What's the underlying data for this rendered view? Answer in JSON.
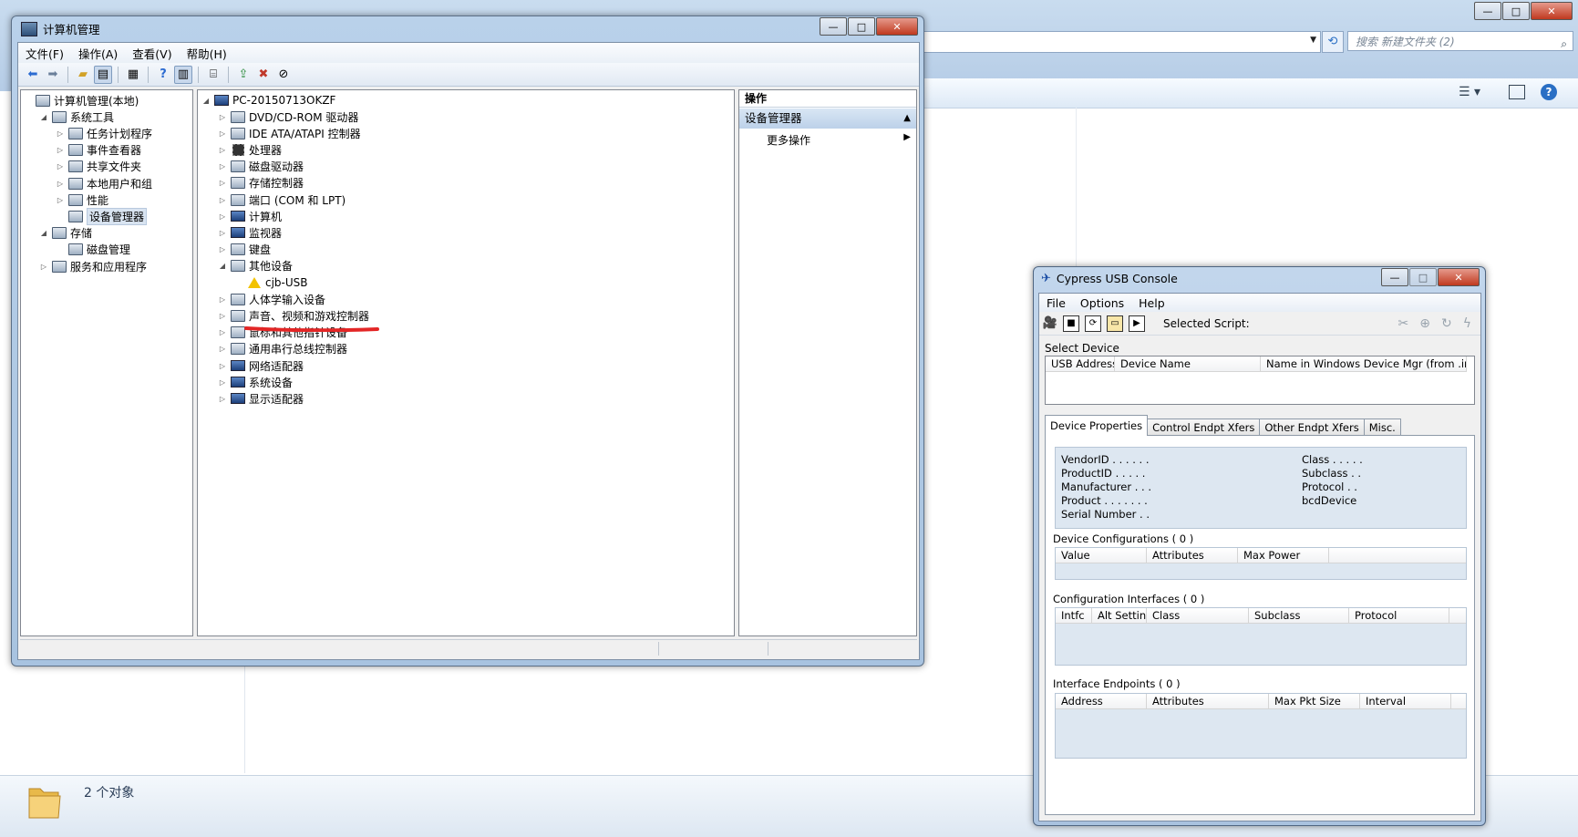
{
  "explorer": {
    "search_placeholder": "搜索 新建文件夹 (2)",
    "status_count": "2 个对象"
  },
  "computer_management": {
    "title": "计算机管理",
    "menu": [
      "文件(F)",
      "操作(A)",
      "查看(V)",
      "帮助(H)"
    ],
    "left_tree": [
      {
        "label": "计算机管理(本地)",
        "level": 0,
        "expander": ""
      },
      {
        "label": "系统工具",
        "level": 1,
        "expander": "◢"
      },
      {
        "label": "任务计划程序",
        "level": 2,
        "expander": "▷"
      },
      {
        "label": "事件查看器",
        "level": 2,
        "expander": "▷"
      },
      {
        "label": "共享文件夹",
        "level": 2,
        "expander": "▷"
      },
      {
        "label": "本地用户和组",
        "level": 2,
        "expander": "▷"
      },
      {
        "label": "性能",
        "level": 2,
        "expander": "▷"
      },
      {
        "label": "设备管理器",
        "level": 2,
        "expander": "",
        "selected": true
      },
      {
        "label": "存储",
        "level": 1,
        "expander": "◢"
      },
      {
        "label": "磁盘管理",
        "level": 2,
        "expander": ""
      },
      {
        "label": "服务和应用程序",
        "level": 1,
        "expander": "▷"
      }
    ],
    "device_tree_root": "PC-20150713OKZF",
    "device_tree": [
      {
        "label": "DVD/CD-ROM 驱动器",
        "expander": "▷"
      },
      {
        "label": "IDE ATA/ATAPI 控制器",
        "expander": "▷"
      },
      {
        "label": "处理器",
        "expander": "▷"
      },
      {
        "label": "磁盘驱动器",
        "expander": "▷"
      },
      {
        "label": "存储控制器",
        "expander": "▷"
      },
      {
        "label": "端口 (COM 和 LPT)",
        "expander": "▷"
      },
      {
        "label": "计算机",
        "expander": "▷"
      },
      {
        "label": "监视器",
        "expander": "▷"
      },
      {
        "label": "键盘",
        "expander": "▷"
      },
      {
        "label": "其他设备",
        "expander": "◢"
      },
      {
        "label": "cjb-USB",
        "expander": "",
        "child": true,
        "warning": true
      },
      {
        "label": "人体学输入设备",
        "expander": "▷"
      },
      {
        "label": "声音、视频和游戏控制器",
        "expander": "▷"
      },
      {
        "label": "鼠标和其他指针设备",
        "expander": "▷"
      },
      {
        "label": "通用串行总线控制器",
        "expander": "▷"
      },
      {
        "label": "网络适配器",
        "expander": "▷"
      },
      {
        "label": "系统设备",
        "expander": "▷"
      },
      {
        "label": "显示适配器",
        "expander": "▷"
      }
    ],
    "actions_header": "操作",
    "actions_group": "设备管理器",
    "actions_more": "更多操作"
  },
  "cypress": {
    "title": "Cypress USB Console",
    "menu": [
      "File",
      "Options",
      "Help"
    ],
    "selected_script_label": "Selected Script:",
    "select_device_label": "Select Device",
    "device_columns": [
      "USB Address",
      "Device Name",
      "Name in Windows Device Mgr (from .inf)"
    ],
    "tabs": [
      "Device Properties",
      "Control Endpt Xfers",
      "Other Endpt Xfers",
      "Misc."
    ],
    "props_left": [
      "VendorID . . . . . .",
      "ProductID  . . . . .",
      "Manufacturer . . .",
      "Product . . . . . . .",
      "Serial Number . ."
    ],
    "props_right": [
      "Class . . . . .",
      "Subclass . .",
      "Protocol . .",
      "bcdDevice"
    ],
    "configs_label": "Device Configurations  ( 0 )",
    "configs_columns": [
      "Value",
      "Attributes",
      "Max Power",
      ""
    ],
    "interfaces_label": "Configuration Interfaces  ( 0 )",
    "interfaces_columns": [
      "Intfc",
      "Alt Setting",
      "Class",
      "Subclass",
      "Protocol",
      ""
    ],
    "endpoints_label": "Interface Endpoints  ( 0 )",
    "endpoints_columns": [
      "Address",
      "Attributes",
      "Max Pkt Size",
      "Interval",
      ""
    ]
  }
}
